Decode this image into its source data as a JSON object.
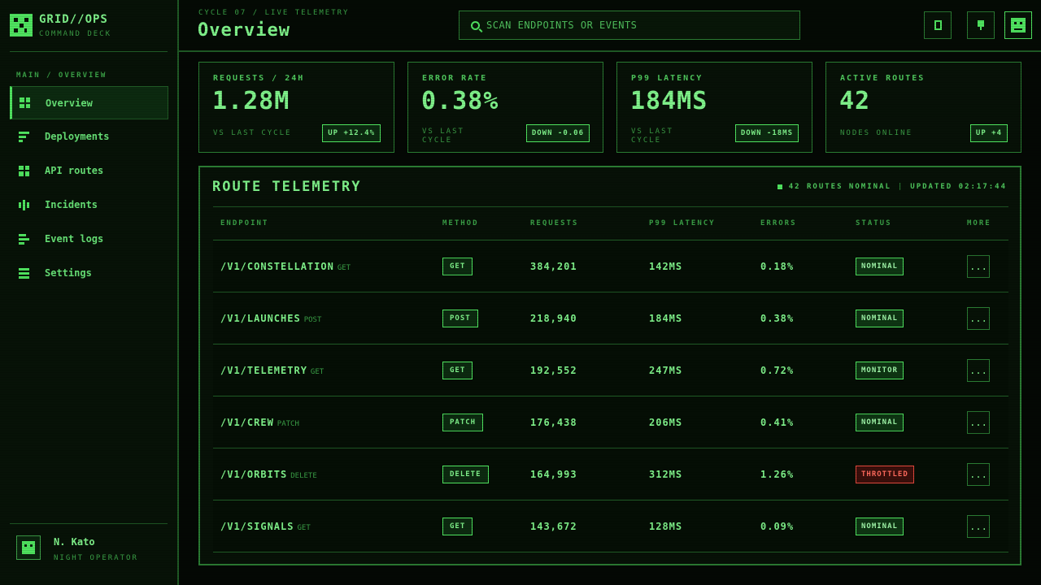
{
  "brand": {
    "name": "GRID//OPS",
    "subtitle": "COMMAND DECK"
  },
  "sidebar": {
    "section": "MAIN / OVERVIEW",
    "items": [
      {
        "label": "Overview",
        "icon": "grid-icon",
        "active": true
      },
      {
        "label": "Deployments",
        "icon": "bars-icon"
      },
      {
        "label": "API routes",
        "icon": "grid-icon"
      },
      {
        "label": "Incidents",
        "icon": "pulse-icon"
      },
      {
        "label": "Event logs",
        "icon": "log-icon"
      },
      {
        "label": "Settings",
        "icon": "list-icon"
      }
    ]
  },
  "user": {
    "name": "N. Kato",
    "role": "NIGHT OPERATOR"
  },
  "header": {
    "breadcrumb": "CYCLE 07 / LIVE TELEMETRY",
    "title": "Overview",
    "search_placeholder": "SCAN ENDPOINTS OR EVENTS"
  },
  "stats": [
    {
      "label": "REQUESTS / 24H",
      "value": "1.28M",
      "sub": "VS LAST CYCLE",
      "badge": "UP +12.4%"
    },
    {
      "label": "ERROR RATE",
      "value": "0.38%",
      "sub": "VS LAST CYCLE",
      "badge": "DOWN -0.06"
    },
    {
      "label": "P99 LATENCY",
      "value": "184MS",
      "sub": "VS LAST CYCLE",
      "badge": "DOWN -18MS"
    },
    {
      "label": "ACTIVE ROUTES",
      "value": "42",
      "sub": "NODES ONLINE",
      "badge": "UP +4"
    }
  ],
  "telemetry": {
    "title": "ROUTE TELEMETRY",
    "status_text": "42 ROUTES NOMINAL",
    "updated": "UPDATED 02:17:44",
    "columns": [
      "ENDPOINT",
      "METHOD",
      "REQUESTS",
      "P99 LATENCY",
      "ERRORS",
      "STATUS",
      "MORE"
    ],
    "rows": [
      {
        "endpoint": "/V1/CONSTELLATION",
        "method_tag": "GET",
        "method": "GET",
        "requests": "384,201",
        "latency": "142MS",
        "errors": "0.18%",
        "status": "NOMINAL"
      },
      {
        "endpoint": "/V1/LAUNCHES",
        "method_tag": "POST",
        "method": "POST",
        "requests": "218,940",
        "latency": "184MS",
        "errors": "0.38%",
        "status": "NOMINAL"
      },
      {
        "endpoint": "/V1/TELEMETRY",
        "method_tag": "GET",
        "method": "GET",
        "requests": "192,552",
        "latency": "247MS",
        "errors": "0.72%",
        "status": "MONITOR"
      },
      {
        "endpoint": "/V1/CREW",
        "method_tag": "PATCH",
        "method": "PATCH",
        "requests": "176,438",
        "latency": "206MS",
        "errors": "0.41%",
        "status": "NOMINAL"
      },
      {
        "endpoint": "/V1/ORBITS",
        "method_tag": "DELETE",
        "method": "DELETE",
        "requests": "164,993",
        "latency": "312MS",
        "errors": "1.26%",
        "status": "THROTTLED"
      },
      {
        "endpoint": "/V1/SIGNALS",
        "method_tag": "GET",
        "method": "GET",
        "requests": "143,672",
        "latency": "128MS",
        "errors": "0.09%",
        "status": "NOMINAL"
      }
    ],
    "more_label": "..."
  },
  "colors": {
    "accent": "#4fe35f",
    "text": "#7ff28a",
    "danger": "#ff6a5c",
    "border": "#2a7a32",
    "background": "#040804"
  }
}
